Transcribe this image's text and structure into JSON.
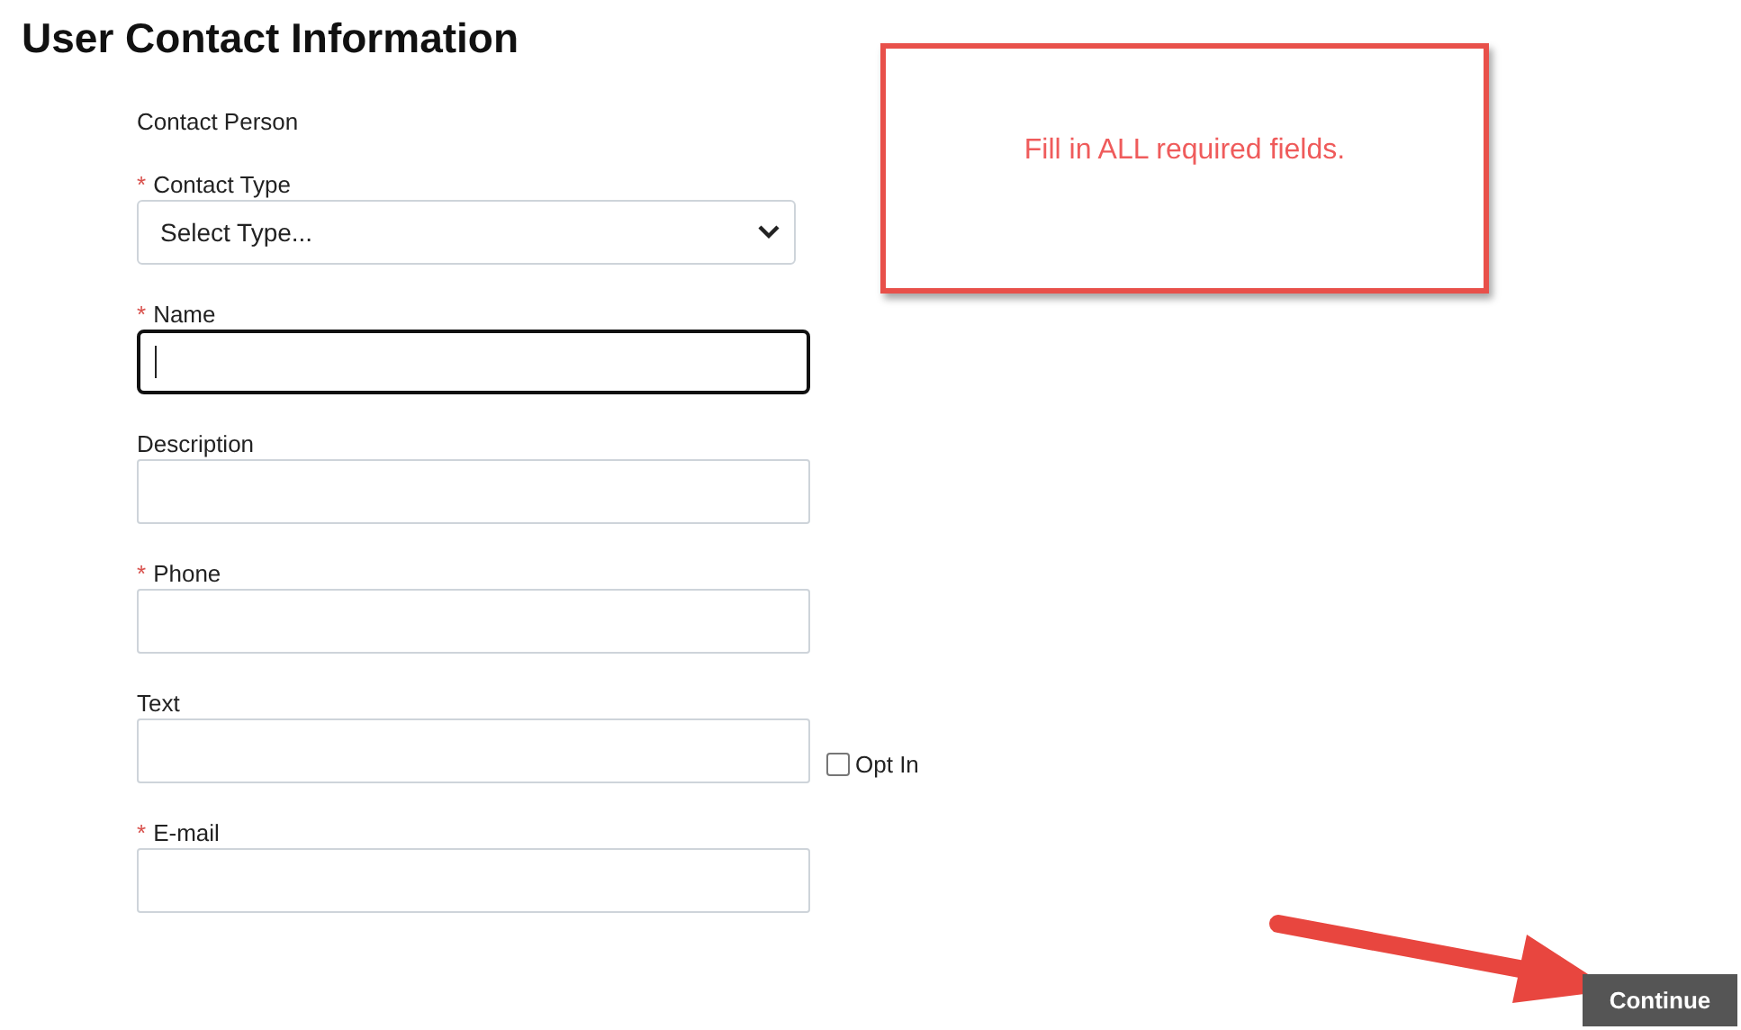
{
  "title": "User Contact Information",
  "section_label": "Contact Person",
  "fields": [
    {
      "kind": "select",
      "label": "Contact Type",
      "required_mark": "*",
      "value": "Select Type..."
    },
    {
      "kind": "text",
      "label": "Name",
      "required_mark": "*",
      "focused": true
    },
    {
      "kind": "text",
      "label": "Description"
    },
    {
      "kind": "text",
      "label": "Phone",
      "required_mark": "*"
    },
    {
      "kind": "text",
      "label": "Text",
      "option": {
        "label": "Opt In",
        "checked": false
      }
    },
    {
      "kind": "text",
      "label": "E-mail",
      "required_mark": "*"
    }
  ],
  "callout": {
    "message": "Fill in ALL required fields."
  },
  "continue_button": "Continue"
}
